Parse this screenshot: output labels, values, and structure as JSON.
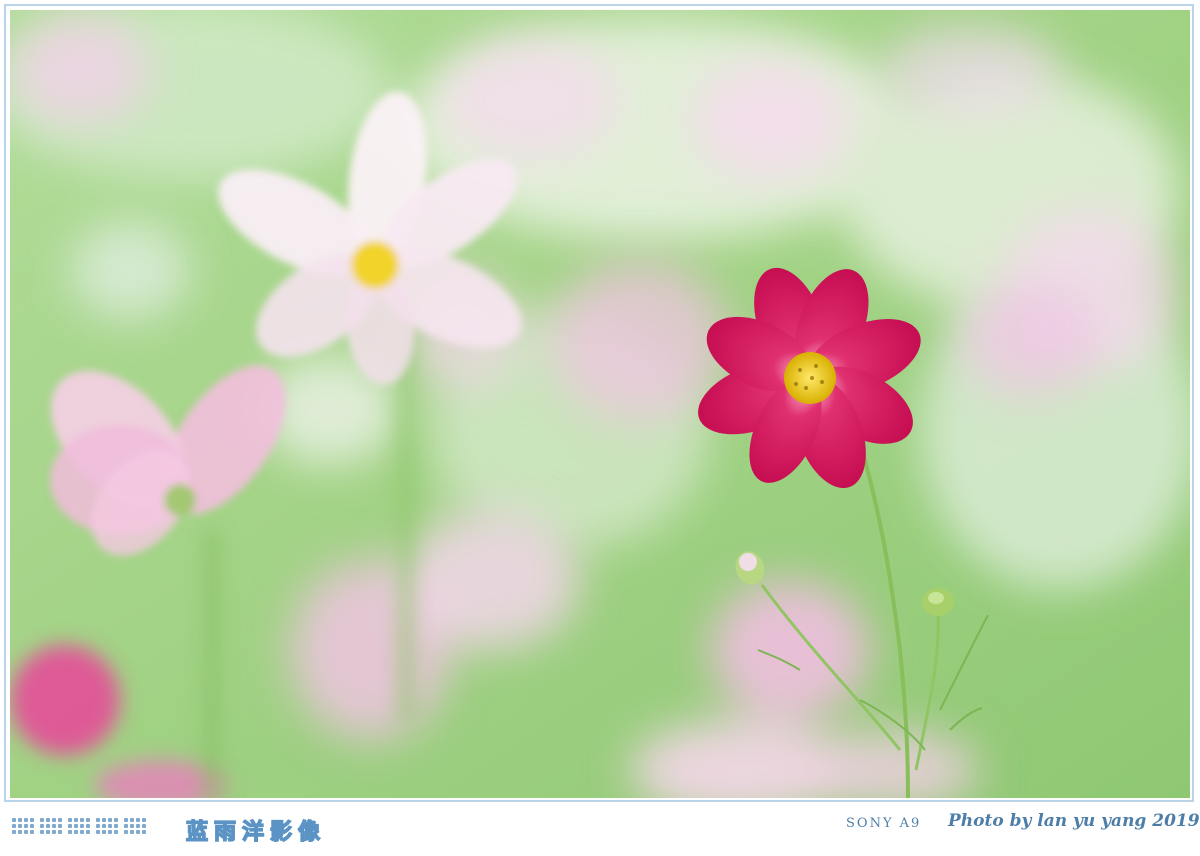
{
  "photo": {
    "subject": "pink cosmos flower",
    "palette": {
      "background_green": "#a6d38c",
      "background_light": "#d8ecd0",
      "blur_pink": "#f3c7e4",
      "flower_magenta": "#d8125e",
      "flower_center": "#f4d410",
      "stem": "#8cc064"
    }
  },
  "footer": {
    "studio_name": "蓝雨洋影像",
    "camera": "SONY A9",
    "credit": "Photo by lan yu yang 2019",
    "accent_color": "#5b93c4",
    "dot_blocks": 5
  }
}
